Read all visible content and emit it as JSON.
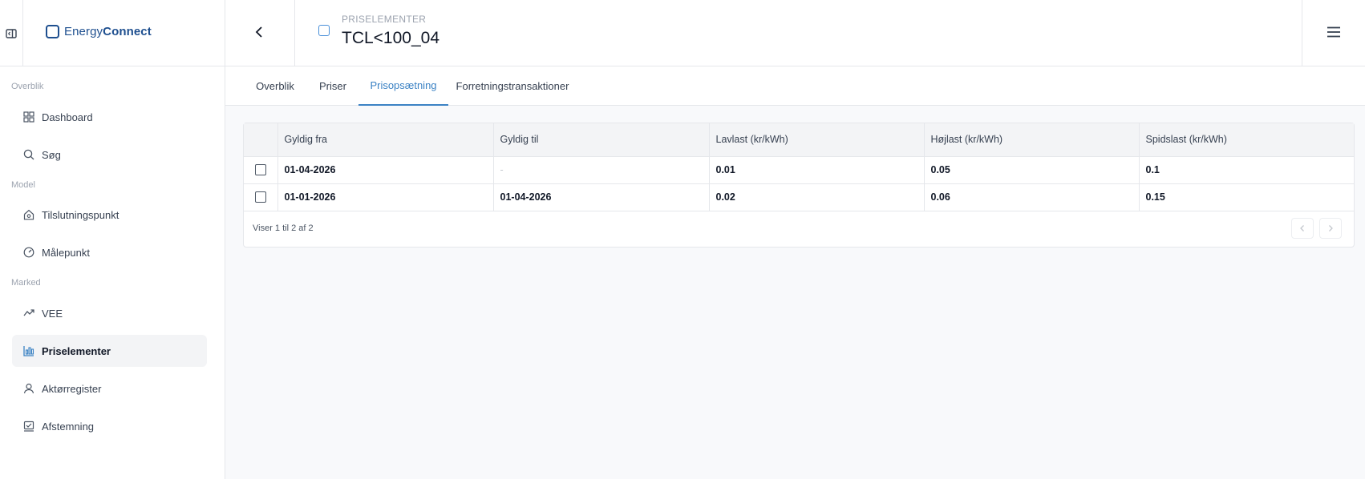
{
  "brand": {
    "name_part1": "Energy",
    "name_part2": "Connect"
  },
  "header": {
    "section": "PRISELEMENTER",
    "title": "TCL<100_04"
  },
  "sidebar": {
    "sections": [
      {
        "label": "Overblik"
      },
      {
        "label": "Model"
      },
      {
        "label": "Marked"
      }
    ],
    "items": [
      {
        "label": "Dashboard",
        "icon": "grid-icon"
      },
      {
        "label": "Søg",
        "icon": "search-icon"
      },
      {
        "label": "Tilslutningspunkt",
        "icon": "house-icon"
      },
      {
        "label": "Målepunkt",
        "icon": "gauge-icon"
      },
      {
        "label": "VEE",
        "icon": "trend-icon"
      },
      {
        "label": "Priselementer",
        "icon": "chart-icon",
        "active": true
      },
      {
        "label": "Aktørregister",
        "icon": "user-icon"
      },
      {
        "label": "Afstemning",
        "icon": "check-icon"
      }
    ]
  },
  "tabs": [
    {
      "label": "Overblik"
    },
    {
      "label": "Priser"
    },
    {
      "label": "Prisopsætning",
      "active": true
    },
    {
      "label": "Forretningstransaktioner"
    }
  ],
  "table": {
    "columns": [
      "Gyldig fra",
      "Gyldig til",
      "Lavlast (kr/kWh)",
      "Højlast (kr/kWh)",
      "Spidslast (kr/kWh)"
    ],
    "rows": [
      [
        "01-04-2026",
        "-",
        "0.01",
        "0.05",
        "0.1"
      ],
      [
        "01-01-2026",
        "01-04-2026",
        "0.02",
        "0.06",
        "0.15"
      ]
    ],
    "footer": "Viser 1 til 2 af 2"
  },
  "colors": {
    "accent": "#3b82c4",
    "brand": "#1e4f8f"
  }
}
